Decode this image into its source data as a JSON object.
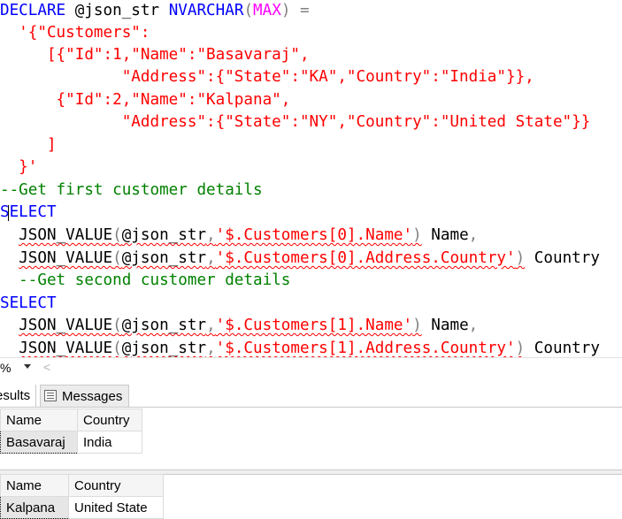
{
  "editor": {
    "code": {
      "declare_kw": "DECLARE",
      "declare_var": " @json_str ",
      "declare_type": "NVARCHAR",
      "declare_paren_open": "(",
      "declare_max": "MAX",
      "declare_paren_close": ")",
      "declare_eq": " =",
      "json_line_1": "  '{\"Customers\":",
      "json_line_2": "     [{\"Id\":1,\"Name\":\"Basavaraj\",",
      "json_line_3": "             \"Address\":{\"State\":\"KA\",\"Country\":\"India\"}},",
      "json_line_4": "      {\"Id\":2,\"Name\":\"Kalpana\",",
      "json_line_5": "             \"Address\":{\"State\":\"NY\",\"Country\":\"United State\"}}",
      "json_line_6": "     ]",
      "json_line_7": "  }'",
      "comment_1": "--Get first customer details",
      "select_1": "SELECT",
      "q1_indent": "  ",
      "q1_fn": "JSON_VALUE",
      "q1_open": "(",
      "q1_var": "@json_str",
      "q1_comma": ",",
      "q1_path": "'$.Customers[0].Name'",
      "q1_close": ")",
      "q1_alias": " Name",
      "q1_tail": ",",
      "q2_indent": "  ",
      "q2_fn": "JSON_VALUE",
      "q2_open": "(",
      "q2_var": "@json_str",
      "q2_comma": ",",
      "q2_path": "'$.Customers[0].Address.Country'",
      "q2_close": ")",
      "q2_alias": " Country",
      "comment_2": "  --Get second customer details",
      "select_2": "SELECT",
      "q3_indent": "  ",
      "q3_fn": "JSON_VALUE",
      "q3_open": "(",
      "q3_var": "@json_str",
      "q3_comma": ",",
      "q3_path": "'$.Customers[1].Name'",
      "q3_close": ")",
      "q3_alias": " Name",
      "q3_tail": ",",
      "q4_indent": "  ",
      "q4_fn": "JSON_VALUE",
      "q4_open": "(",
      "q4_var": "@json_str",
      "q4_comma": ",",
      "q4_path": "'$.Customers[1].Address.Country'",
      "q4_close": ")",
      "q4_alias": " Country"
    }
  },
  "zoom": {
    "value": "%",
    "dropdown_icon": "chevron-down-icon",
    "scroll_icon": "chevron-left-icon",
    "scroll_glyph": "<"
  },
  "tabs": {
    "results_label": "esults",
    "messages_label": "Messages",
    "messages_icon": "messages-icon"
  },
  "results": [
    {
      "columns": [
        "Name",
        "Country"
      ],
      "rows": [
        [
          "Basavaraj",
          "India"
        ]
      ]
    },
    {
      "columns": [
        "Name",
        "Country"
      ],
      "rows": [
        [
          "Kalpana",
          "United State"
        ]
      ]
    }
  ],
  "colors": {
    "keyword": "#0000ff",
    "function": "#ff00ff",
    "string": "#ff0000",
    "comment": "#008000",
    "operator": "#808080"
  }
}
